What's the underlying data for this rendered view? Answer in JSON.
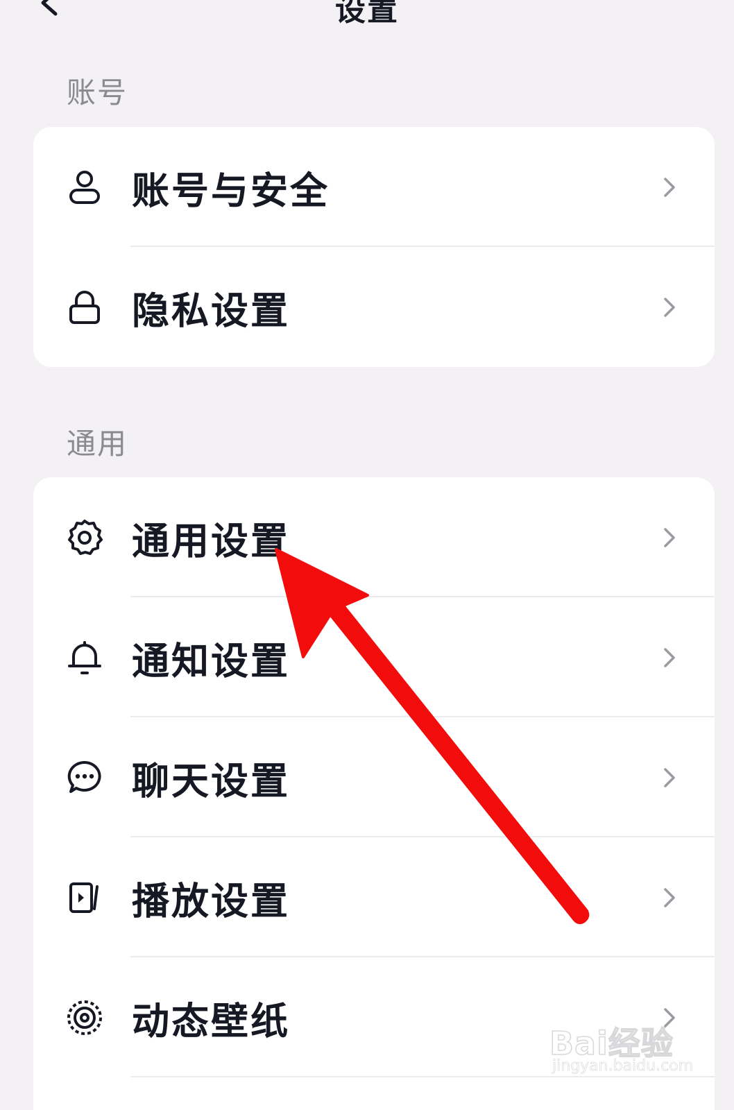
{
  "header": {
    "title": "设置",
    "back_icon": "chevron-left-icon"
  },
  "sections": {
    "account": {
      "label": "账号",
      "items": [
        {
          "label": "账号与安全",
          "icon": "user-icon"
        },
        {
          "label": "隐私设置",
          "icon": "lock-icon"
        }
      ]
    },
    "general": {
      "label": "通用",
      "items": [
        {
          "label": "通用设置",
          "icon": "gear-icon"
        },
        {
          "label": "通知设置",
          "icon": "bell-icon"
        },
        {
          "label": "聊天设置",
          "icon": "chat-bubble-icon"
        },
        {
          "label": "播放设置",
          "icon": "play-icon"
        },
        {
          "label": "动态壁纸",
          "icon": "wallpaper-icon"
        }
      ]
    }
  },
  "annotation": {
    "arrow_color": "#f20c0c",
    "points_to": "通用设置"
  },
  "watermark": {
    "brand": "Bai经验",
    "url": "jingyan.baidu.com"
  },
  "colors": {
    "background": "#f3f1f4",
    "card": "#ffffff",
    "text_primary": "#161823",
    "text_secondary": "#8a8b91",
    "chevron": "#9a9ba1"
  }
}
